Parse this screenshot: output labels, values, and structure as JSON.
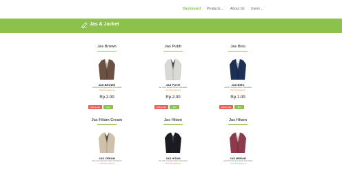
{
  "nav": {
    "items": [
      {
        "label": "Dashboard",
        "dropdown": false
      },
      {
        "label": "Products",
        "dropdown": true
      },
      {
        "label": "About Us",
        "dropdown": false
      },
      {
        "label": "Users",
        "dropdown": true
      }
    ]
  },
  "banner": {
    "title": "Jas & Jacket"
  },
  "products": [
    {
      "title": "Jas Brown",
      "label": "JAS BROWN",
      "desc": "Jas Brown dengan bahan berkualitas",
      "link": "Lihat Selengkapnya",
      "price": "Rp.2.00",
      "btn_cart": "Add to Cart",
      "btn_buy": "Beli",
      "color": "#6b5043"
    },
    {
      "title": "Jas Putih",
      "label": "JAS PUTIH",
      "desc": "Jas Putih dengan bahan berkualitas",
      "link": "Lihat Selengkapnya",
      "price": "Rp.2.00",
      "btn_cart": "Add to Cart",
      "btn_buy": "Beli",
      "color": "#d9d9d6"
    },
    {
      "title": "Jas Biru",
      "label": "JAS BIRU",
      "desc": "Jas Biru dengan bahan berkualitas",
      "link": "Lihat Selengkapnya",
      "price": "Rp.1.00",
      "btn_cart": "Add to Cart",
      "btn_buy": "Beli",
      "color": "#1e2f56"
    },
    {
      "title": "Jas Hitam Cream",
      "label": "JAS CREAM",
      "desc": "Jas Cream dengan bahan berkualitas",
      "link": "Lihat Selengkapnya",
      "color": "#cfc0a9"
    },
    {
      "title": "Jas Hitam",
      "label": "JAS HITAM",
      "desc": "Jas Hitam dengan bahan berkualitas",
      "link": "Lihat Selengkapnya",
      "color": "#1b1b22"
    },
    {
      "title": "Jas Hitam",
      "label": "JAS MERAH",
      "desc": "Jas Merah dengan bahan berkualitas",
      "link": "Lihat Selengkapnya",
      "color": "#8c3a4c"
    }
  ]
}
